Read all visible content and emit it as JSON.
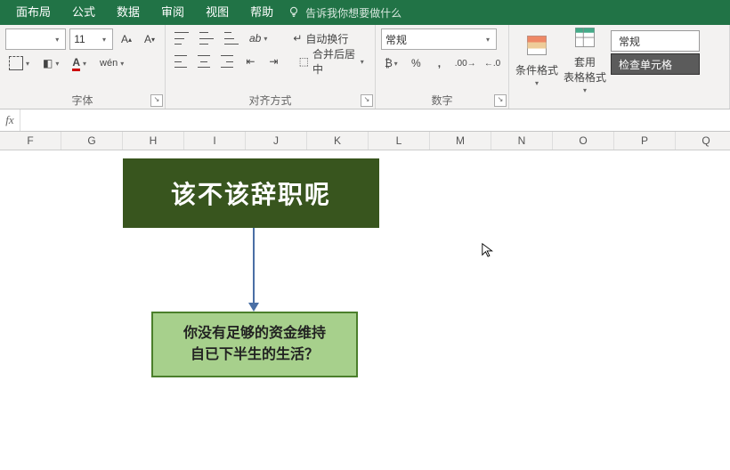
{
  "menu": {
    "items": [
      "面布局",
      "公式",
      "数据",
      "审阅",
      "视图",
      "帮助"
    ],
    "tellme": "告诉我你想要做什么"
  },
  "ribbon": {
    "font": {
      "size": "11",
      "group_label": "字体"
    },
    "alignment": {
      "wrap": "自动换行",
      "merge": "合并后居中",
      "group_label": "对齐方式"
    },
    "number": {
      "format": "常规",
      "group_label": "数字"
    },
    "styles": {
      "cond": "条件格式",
      "table": "套用\n表格格式",
      "normal": "常规",
      "check": "检查单元格"
    }
  },
  "formula_bar": {
    "fx": "fx",
    "value": ""
  },
  "columns": [
    "F",
    "G",
    "H",
    "I",
    "J",
    "K",
    "L",
    "M",
    "N",
    "O",
    "P",
    "Q"
  ],
  "shapes": {
    "title": "该不该辞职呢",
    "question": "你没有足够的资金维持\n自已下半生的生活？"
  }
}
